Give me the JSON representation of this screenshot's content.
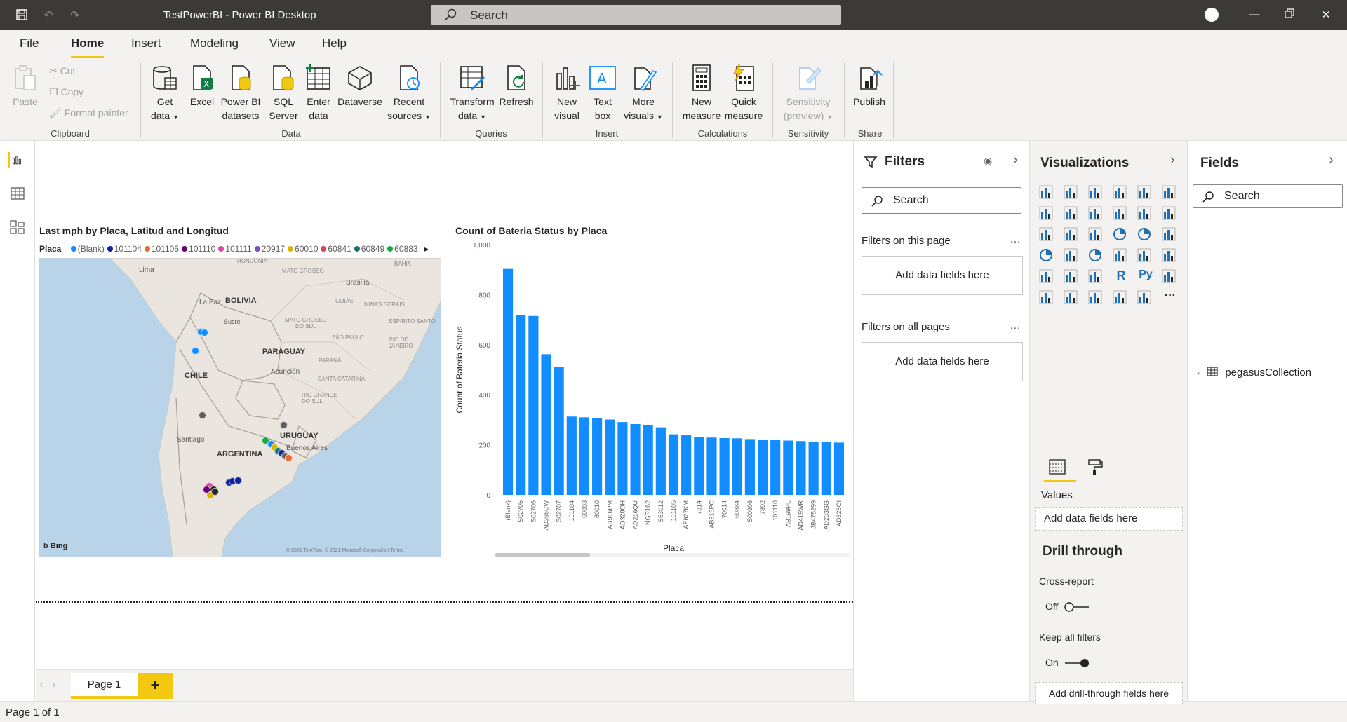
{
  "titlebar": {
    "title": "TestPowerBI - Power BI Desktop",
    "search_placeholder": "Search"
  },
  "ribbon": {
    "tabs": [
      "File",
      "Home",
      "Insert",
      "Modeling",
      "View",
      "Help"
    ],
    "active_tab": "Home",
    "clipboard": {
      "paste": "Paste",
      "cut": "Cut",
      "copy": "Copy",
      "format_painter": "Format painter",
      "label": "Clipboard"
    },
    "data": {
      "get_data": [
        "Get",
        "data"
      ],
      "excel": "Excel",
      "pbi_datasets": [
        "Power BI",
        "datasets"
      ],
      "sql_server": [
        "SQL",
        "Server"
      ],
      "enter_data": [
        "Enter",
        "data"
      ],
      "dataverse": "Dataverse",
      "recent_sources": [
        "Recent",
        "sources"
      ],
      "label": "Data"
    },
    "queries": {
      "transform": [
        "Transform",
        "data"
      ],
      "refresh": "Refresh",
      "label": "Queries"
    },
    "insert": {
      "new_visual": [
        "New",
        "visual"
      ],
      "text_box": [
        "Text",
        "box"
      ],
      "more_visuals": [
        "More",
        "visuals"
      ],
      "label": "Insert"
    },
    "calculations": {
      "new_measure": [
        "New",
        "measure"
      ],
      "quick_measure": [
        "Quick",
        "measure"
      ],
      "label": "Calculations"
    },
    "sensitivity": {
      "button": [
        "Sensitivity",
        "(preview)"
      ],
      "label": "Sensitivity"
    },
    "share": {
      "publish": "Publish",
      "label": "Share"
    }
  },
  "map_visual": {
    "title": "Last mph by Placa, Latitud and Longitud",
    "legend_title": "Placa",
    "legend": [
      {
        "name": "(Blank)",
        "color": "#118dff"
      },
      {
        "name": "101104",
        "color": "#12239e"
      },
      {
        "name": "101105",
        "color": "#e66c37"
      },
      {
        "name": "101110",
        "color": "#6b007b"
      },
      {
        "name": "101111",
        "color": "#e044a7"
      },
      {
        "name": "20917",
        "color": "#744ec2"
      },
      {
        "name": "60010",
        "color": "#d9b300"
      },
      {
        "name": "60841",
        "color": "#d64550"
      },
      {
        "name": "60849",
        "color": "#197278"
      },
      {
        "name": "60883",
        "color": "#1aab40"
      }
    ],
    "labels": {
      "lima": "Lima",
      "rondonia": "RONDÔNIA",
      "mato_grosso": "MATO GROSSO",
      "bahia": "BAHIA",
      "brasilia": "Brasília",
      "goias": "GOIÁS",
      "minas": "MINAS GERAIS",
      "la_paz": "La Paz",
      "bolivia": "BOLIVIA",
      "sucre": "Sucre",
      "mgs": [
        "MATO GROSSO",
        "DO SUL"
      ],
      "sao_paulo": "SÃO PAULO",
      "espirito": "ESPÍRITO SANTO",
      "rio": [
        "RIO DE",
        "JANEIRO"
      ],
      "paraguay": "PARAGUAY",
      "parana": "PARANÁ",
      "asuncion": "Asunción",
      "chile": "CHILE",
      "santa_catarina": "SANTA CATARINA",
      "rgs": [
        "RIO GRANDE",
        "DO SUL"
      ],
      "uruguay": "URUGUAY",
      "santiago": "Santiago",
      "buenos_aires": "Buenos Aires",
      "argentina": "ARGENTINA",
      "bing": "Bing",
      "copyright": "© 2021 TomTom, © 2021 Microsoft Corporation  Terms"
    }
  },
  "chart_data": {
    "type": "bar",
    "title": "Count of Bateria Status by Placa",
    "xlabel": "Placa",
    "ylabel": "Count of Bateria Status",
    "ylim": [
      0,
      1000
    ],
    "yticks": [
      "0",
      "200",
      "400",
      "600",
      "800",
      "1,000"
    ],
    "bar_color": "#118dff",
    "categories": [
      "(Blank)",
      "S02705",
      "S02706",
      "AD365CW",
      "S02707",
      "101104",
      "60883",
      "60010",
      "AB916PM",
      "AD328OH",
      "AD216QU",
      "NGR162",
      "S53012",
      "101105",
      "AE627KM",
      "7314",
      "AB916PC",
      "70014",
      "60884",
      "S00906",
      "7892",
      "101110",
      "AB199PL",
      "AD419WR",
      "JB475299",
      "AD233GG",
      "AD328OI"
    ],
    "values": [
      903,
      720,
      715,
      562,
      510,
      313,
      310,
      307,
      301,
      291,
      283,
      278,
      270,
      242,
      238,
      230,
      229,
      227,
      226,
      223,
      221,
      219,
      217,
      215,
      213,
      211,
      209
    ]
  },
  "filters": {
    "title": "Filters",
    "search_placeholder": "Search",
    "on_this_page": "Filters on this page",
    "on_all_pages": "Filters on all pages",
    "add_fields": "Add data fields here"
  },
  "visualizations": {
    "title": "Visualizations",
    "values_label": "Values",
    "add_fields": "Add data fields here",
    "drill_through": "Drill through",
    "cross_report": "Cross-report",
    "cross_report_state": "Off",
    "keep_all_filters": "Keep all filters",
    "keep_all_state": "On",
    "add_drill": "Add drill-through fields here"
  },
  "fields": {
    "title": "Fields",
    "search_placeholder": "Search",
    "tables": [
      "pegasusCollection"
    ]
  },
  "pages": {
    "tabs": [
      "Page 1"
    ],
    "add": "+"
  },
  "status": {
    "page_info": "Page 1 of 1"
  }
}
